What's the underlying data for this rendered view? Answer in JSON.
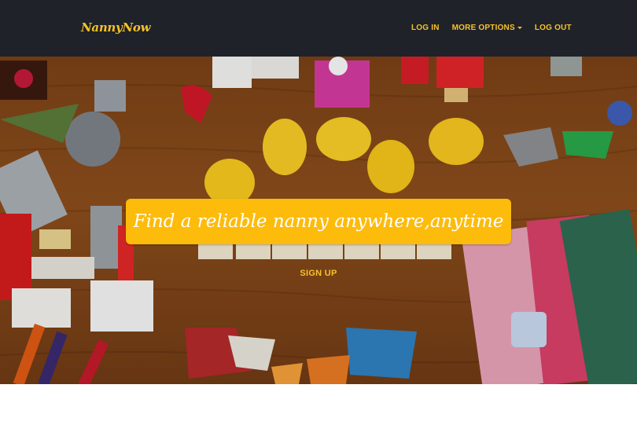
{
  "brand": {
    "name": "NannyNow"
  },
  "nav": {
    "login": "LOG IN",
    "more_options": "MORE OPTIONS",
    "logout": "LOG OUT"
  },
  "hero": {
    "tagline": "Find a reliable nanny anywhere,anytime",
    "signup": "SIGN UP",
    "background": "wooden table with scattered toys: lego bricks, yellow egg figures, crayons, dragons and books"
  },
  "colors": {
    "navbar_bg": "#1f2228",
    "accent": "#f7c22a",
    "tagline_box": "#fdbb0b",
    "wood": "#8b4d1c"
  },
  "icons": {
    "dropdown": "caret-down-icon"
  }
}
